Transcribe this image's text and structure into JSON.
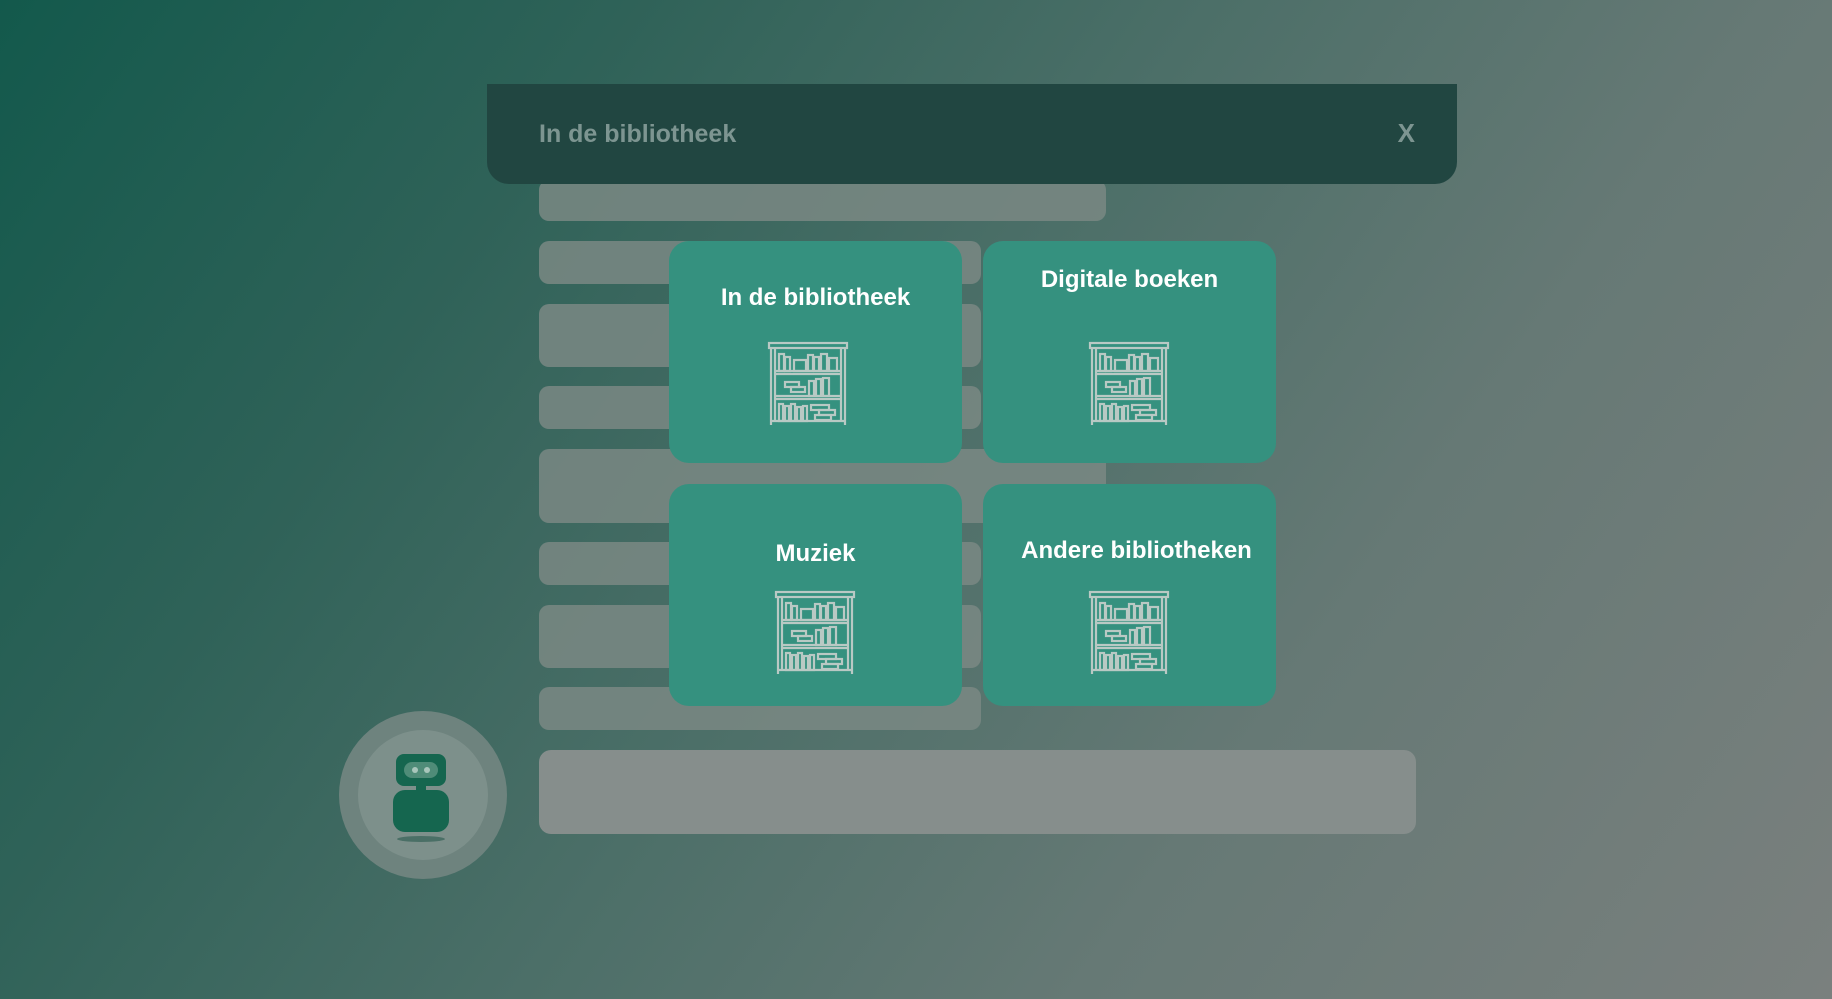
{
  "dialog": {
    "title": "In de bibliotheek",
    "close_label": "X"
  },
  "options": [
    {
      "label": "In de bibliotheek",
      "icon": "bookshelf-icon"
    },
    {
      "label": "Digitale boeken",
      "icon": "bookshelf-icon"
    },
    {
      "label": "Muziek",
      "icon": "bookshelf-icon"
    },
    {
      "label": "Andere bibliotheken",
      "icon": "bookshelf-icon"
    }
  ],
  "colors": {
    "tile": "#35917f",
    "header": "#214641",
    "icon_stroke": "#b9c9c4"
  }
}
